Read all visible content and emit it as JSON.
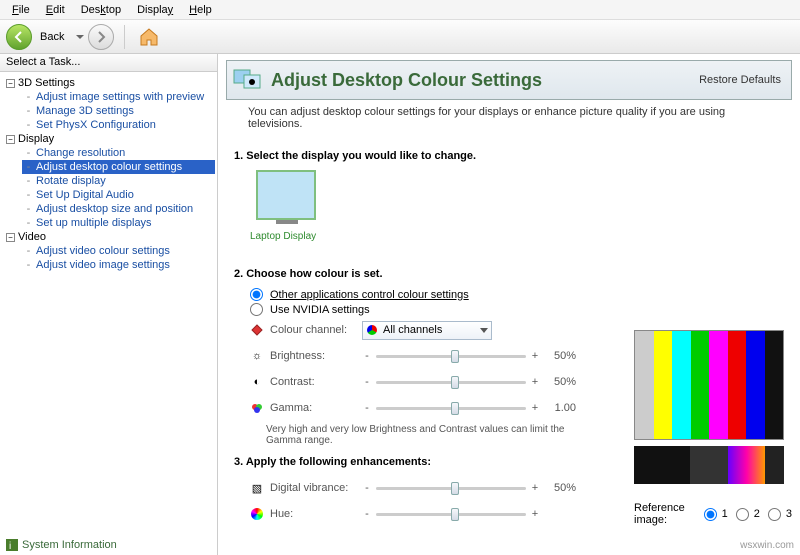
{
  "menu": {
    "file": "File",
    "edit": "Edit",
    "desktop": "Desktop",
    "display": "Display",
    "help": "Help"
  },
  "toolbar": {
    "back": "Back"
  },
  "sidebar": {
    "header": "Select a Task...",
    "cats": [
      {
        "name": "3D Settings",
        "items": [
          "Adjust image settings with preview",
          "Manage 3D settings",
          "Set PhysX Configuration"
        ]
      },
      {
        "name": "Display",
        "items": [
          "Change resolution",
          "Adjust desktop colour settings",
          "Rotate display",
          "Set Up Digital Audio",
          "Adjust desktop size and position",
          "Set up multiple displays"
        ]
      },
      {
        "name": "Video",
        "items": [
          "Adjust video colour settings",
          "Adjust video image settings"
        ]
      }
    ],
    "selected": "Adjust desktop colour settings"
  },
  "banner": {
    "title": "Adjust Desktop Colour Settings",
    "restore": "Restore Defaults"
  },
  "desc": "You can adjust desktop colour settings for your displays or enhance picture quality if you are using televisions.",
  "step1": "1. Select the display you would like to change.",
  "display_name": "Laptop Display",
  "step2": "2. Choose how colour is set.",
  "radio": {
    "other": "Other applications control colour settings",
    "nvidia": "Use NVIDIA settings"
  },
  "channel": {
    "label": "Colour channel:",
    "value": "All channels"
  },
  "sliders": {
    "brightness": {
      "label": "Brightness:",
      "value": "50%",
      "pos": 50
    },
    "contrast": {
      "label": "Contrast:",
      "value": "50%",
      "pos": 50
    },
    "gamma": {
      "label": "Gamma:",
      "value": "1.00",
      "pos": 50
    },
    "vibrance": {
      "label": "Digital vibrance:",
      "value": "50%",
      "pos": 50
    },
    "hue": {
      "label": "Hue:",
      "value": "",
      "pos": 50
    }
  },
  "gamma_note": "Very high and very low Brightness and Contrast values can limit the Gamma range.",
  "step3": "3. Apply the following enhancements:",
  "ref": {
    "label": "Reference image:",
    "o1": "1",
    "o2": "2",
    "o3": "3"
  },
  "footer": "System Information",
  "watermark": "wsxwin.com"
}
